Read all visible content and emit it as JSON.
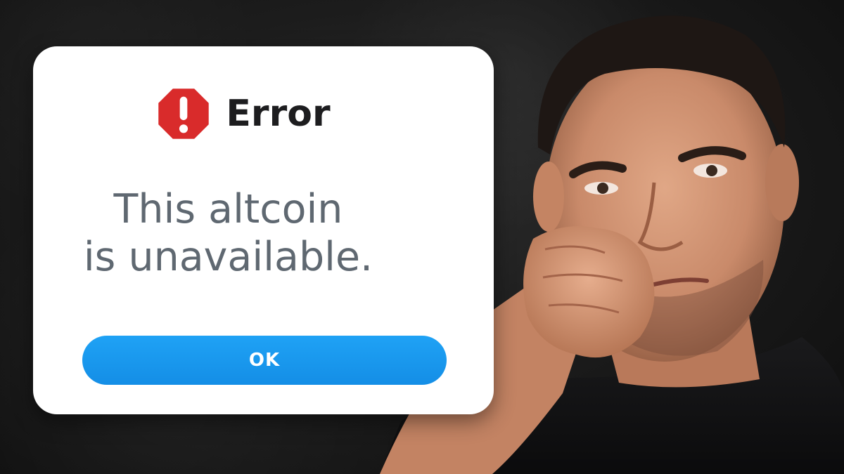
{
  "dialog": {
    "title": "Error",
    "message_line1": "This altcoin",
    "message_line2": "is unavailable.",
    "ok_label": "OK",
    "icon": "stop-sign-exclamation-icon"
  },
  "colors": {
    "button": "#1a98ee",
    "icon_red": "#d92b2b",
    "message_text": "#5f6871",
    "title_text": "#1d1d1f"
  }
}
